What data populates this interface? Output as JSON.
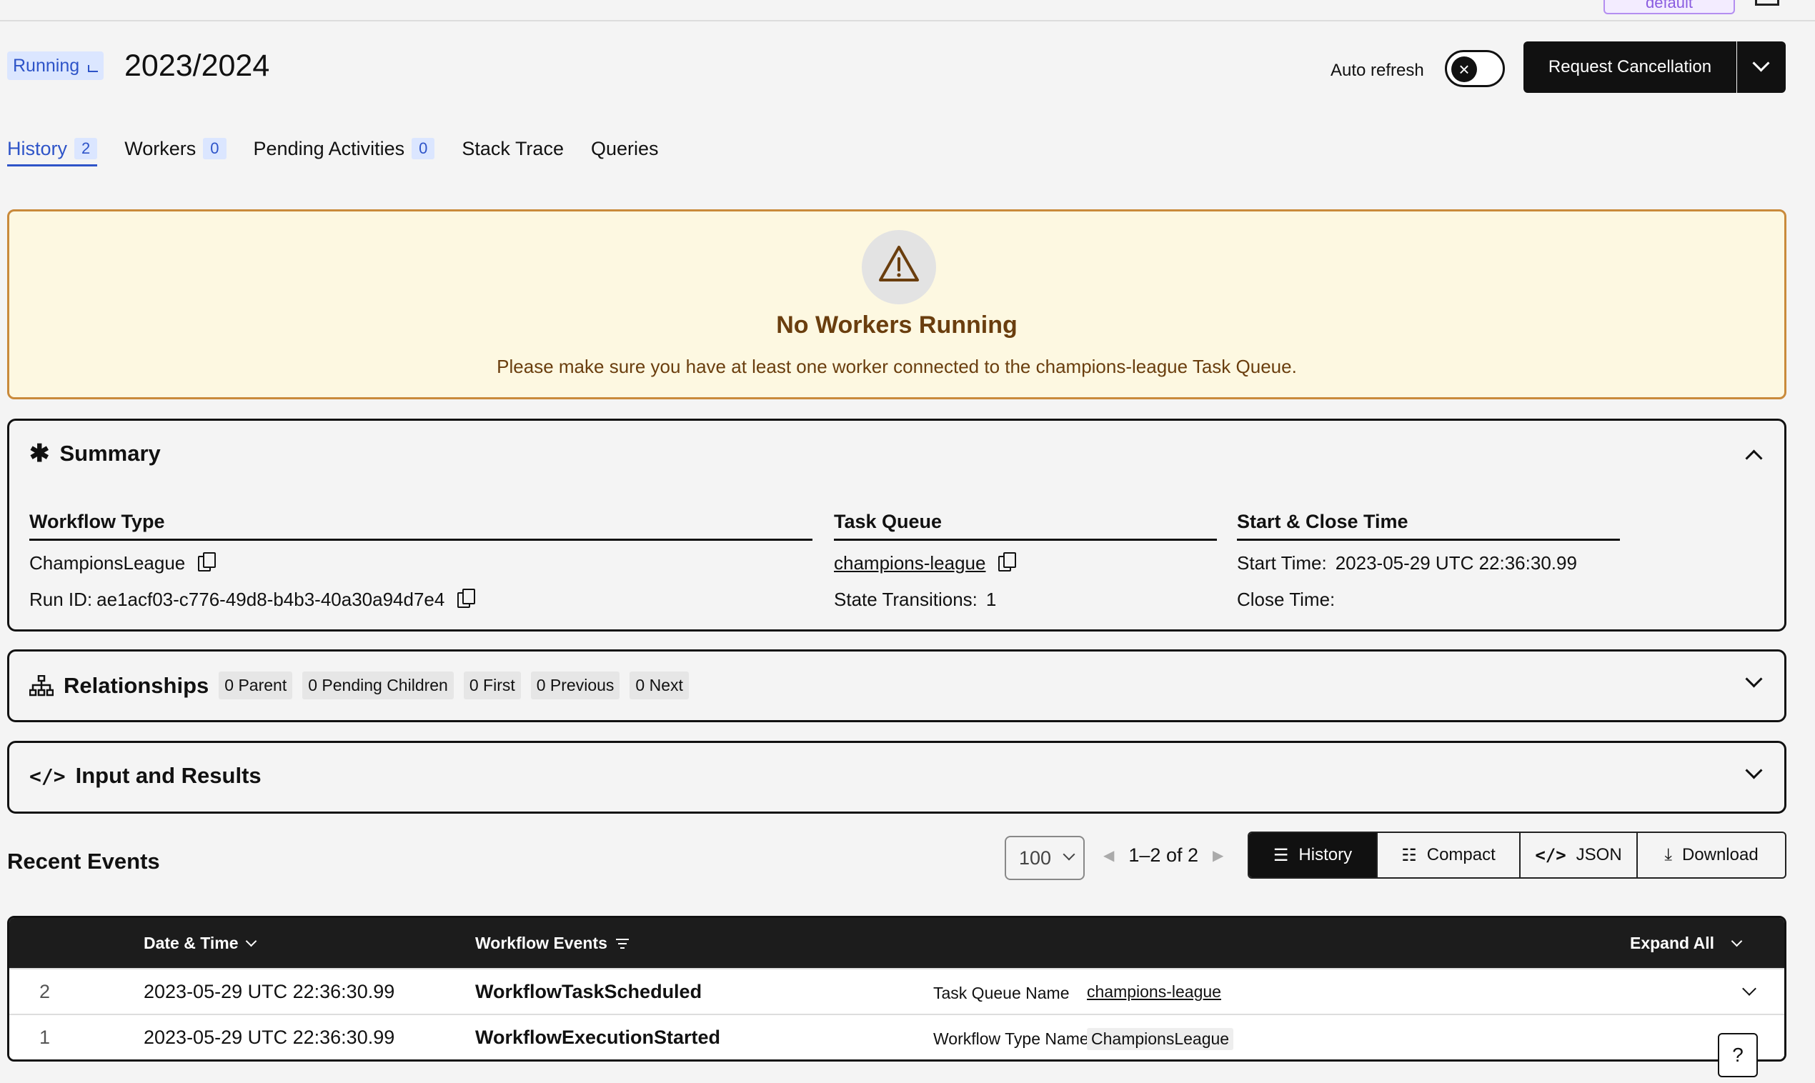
{
  "header": {
    "namespace_label": "default",
    "status": "Running",
    "title": "2023/2024",
    "auto_refresh_label": "Auto refresh",
    "cancel_label": "Request Cancellation"
  },
  "tabs": [
    {
      "label": "History",
      "count": "2"
    },
    {
      "label": "Workers",
      "count": "0"
    },
    {
      "label": "Pending Activities",
      "count": "0"
    },
    {
      "label": "Stack Trace"
    },
    {
      "label": "Queries"
    }
  ],
  "warning": {
    "title": "No Workers Running",
    "message": "Please make sure you have at least one worker connected to the champions-league Task Queue."
  },
  "summary": {
    "title": "Summary",
    "workflow_type_heading": "Workflow Type",
    "workflow_type": "ChampionsLeague",
    "run_id_label": "Run ID:",
    "run_id": "ae1acf03-c776-49d8-b4b3-40a30a94d7e4",
    "task_queue_heading": "Task Queue",
    "task_queue": "champions-league",
    "state_transitions_label": "State Transitions:",
    "state_transitions": "1",
    "time_heading": "Start & Close Time",
    "start_time_label": "Start Time:",
    "start_time": "2023-05-29 UTC 22:36:30.99",
    "close_time_label": "Close Time:"
  },
  "relationships": {
    "title": "Relationships",
    "chips": [
      "0 Parent",
      "0 Pending Children",
      "0 First",
      "0 Previous",
      "0 Next"
    ]
  },
  "input_results": {
    "title": "Input and Results"
  },
  "recent_events": {
    "title": "Recent Events",
    "page_size": "100",
    "range": "1–2 of 2",
    "views": [
      "History",
      "Compact",
      "JSON",
      "Download"
    ],
    "columns": {
      "date": "Date & Time",
      "events": "Workflow Events",
      "expand": "Expand All"
    },
    "rows": [
      {
        "id": "2",
        "date": "2023-05-29 UTC 22:36:30.99",
        "name": "WorkflowTaskScheduled",
        "key": "Task Queue Name",
        "value": "champions-league"
      },
      {
        "id": "1",
        "date": "2023-05-29 UTC 22:36:30.99",
        "name": "WorkflowExecutionStarted",
        "key": "Workflow Type Name",
        "value": "ChampionsLeague"
      }
    ]
  },
  "help_label": "?"
}
